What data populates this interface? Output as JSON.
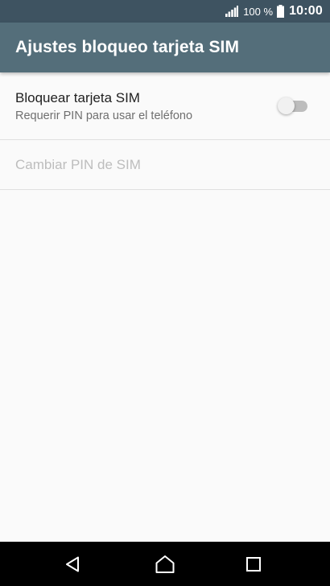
{
  "status_bar": {
    "battery_text": "100 %",
    "time": "10:00",
    "icons": [
      "signal-icon",
      "battery-icon"
    ]
  },
  "toolbar": {
    "title": "Ajustes bloqueo tarjeta SIM"
  },
  "preferences": [
    {
      "title": "Bloquear tarjeta SIM",
      "summary": "Requerir PIN para usar el teléfono",
      "switch_on": false,
      "enabled": true
    },
    {
      "title": "Cambiar PIN de SIM",
      "enabled": false
    }
  ],
  "nav_bar": {
    "icons": [
      "back-icon",
      "home-icon",
      "recents-icon"
    ]
  },
  "colors": {
    "status_bar": "#3e5361",
    "toolbar": "#546e7a",
    "background": "#fafafa",
    "nav_bar": "#000000"
  }
}
